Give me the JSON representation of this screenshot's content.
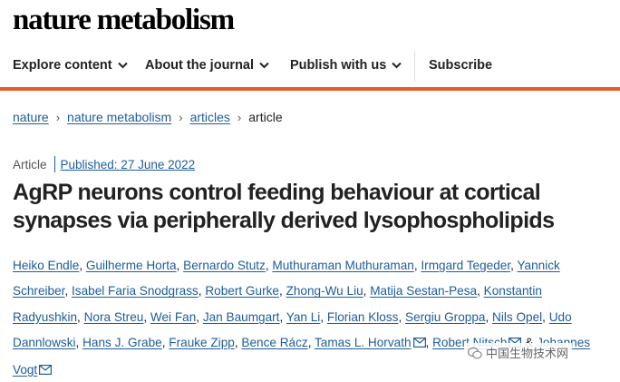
{
  "logo": "nature metabolism",
  "nav": {
    "items": [
      "Explore content",
      "About the journal",
      "Publish with us"
    ],
    "subscribe": "Subscribe"
  },
  "breadcrumb": {
    "items": [
      "nature",
      "nature metabolism",
      "articles"
    ],
    "current": "article"
  },
  "article": {
    "type": "Article",
    "published": "Published: 27 June 2022",
    "title": "AgRP neurons control feeding behaviour at cortical synapses via peripherally derived lysophospholipids"
  },
  "authors": [
    "Heiko Endle",
    "Guilherme Horta",
    "Bernardo Stutz",
    "Muthuraman Muthuraman",
    "Irmgard Tegeder",
    "Yannick Schreiber",
    "Isabel Faria Snodgrass",
    "Robert Gurke",
    "Zhong-Wu Liu",
    "Matija Sestan-Pesa",
    "Konstantin Radyushkin",
    "Nora Streu",
    "Wei Fan",
    "Jan Baumgart",
    "Yan Li",
    "Florian Kloss",
    "Sergiu Groppa",
    "Nils Opel",
    "Udo Dannlowski",
    "Hans J. Grabe",
    "Frauke Zipp",
    "Bence Rácz",
    "Tamas L. Horvath",
    "Robert Nitsch",
    "Johannes Vogt"
  ],
  "authors_ampersand": "&",
  "watermark": "中国生物技术网"
}
